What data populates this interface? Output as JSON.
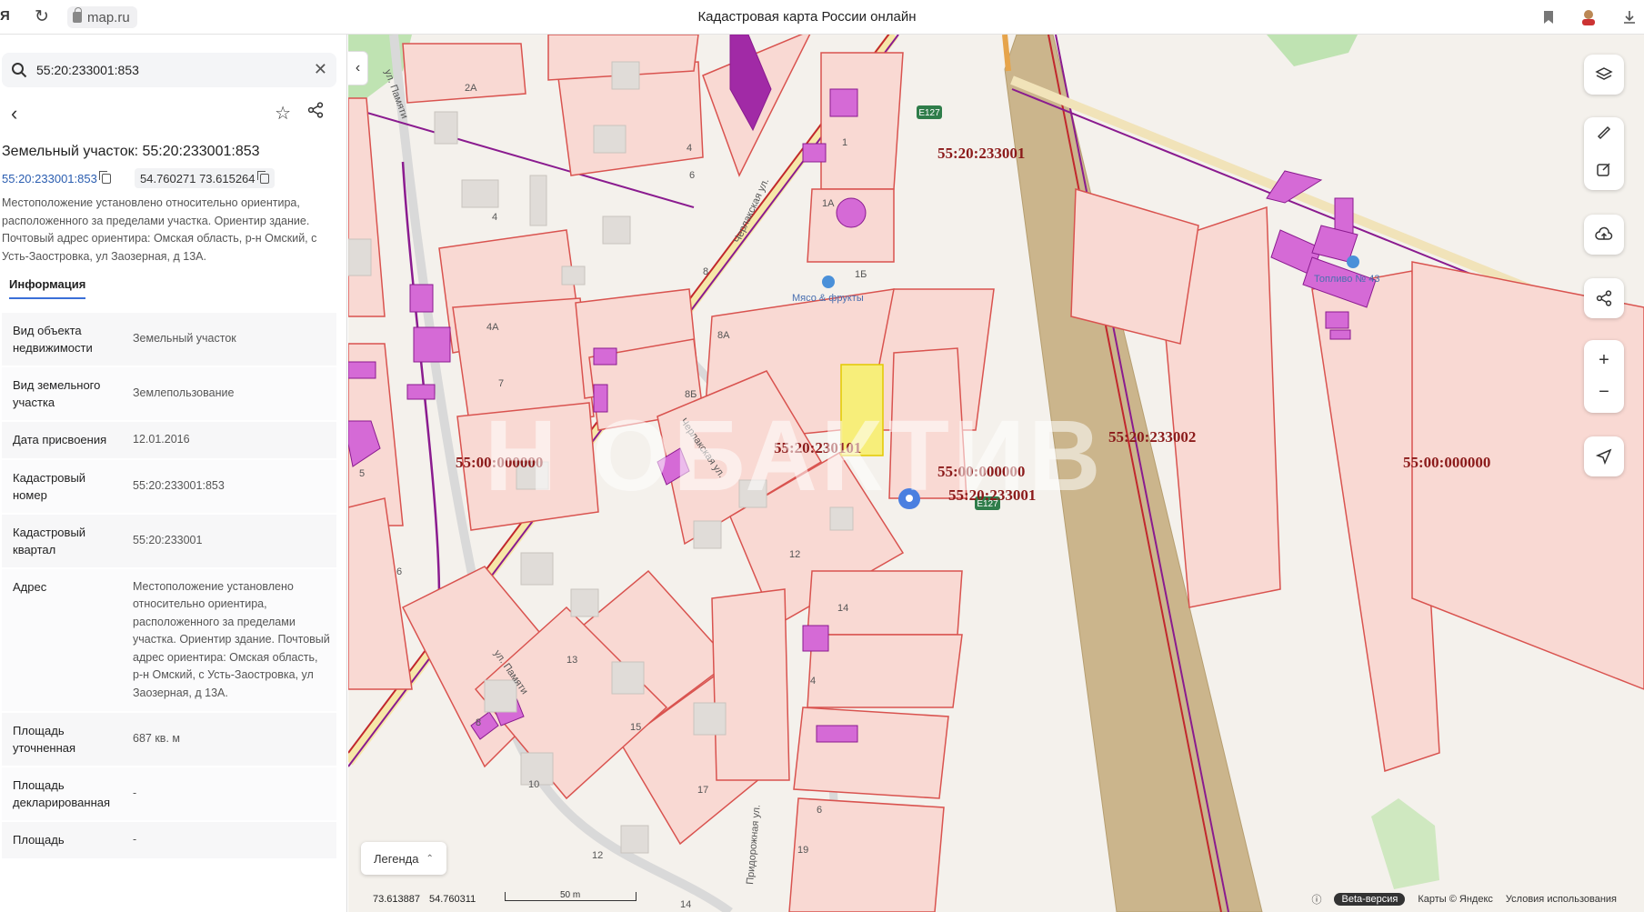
{
  "browser": {
    "brand": "Я",
    "url": "map.ru",
    "tab_title": "Кадастровая карта России онлайн"
  },
  "search": {
    "value": "55:20:233001:853"
  },
  "parcel": {
    "title": "Земельный участок: 55:20:233001:853",
    "cadastral_link": "55:20:233001:853",
    "coordinates": "54.760271 73.615264",
    "description": "Местоположение установлено относительно ориентира, расположенного за пределами участка. Ориентир здание. Почтовый адрес ориентира: Омская область, р-н Омский, с Усть-Заостровка, ул Заозерная, д 13А."
  },
  "tabs": {
    "info": "Информация"
  },
  "info_rows": [
    {
      "label": "Вид объекта недвижимости",
      "value": "Земельный участок"
    },
    {
      "label": "Вид земельного участка",
      "value": "Землепользование"
    },
    {
      "label": "Дата присвоения",
      "value": "12.01.2016"
    },
    {
      "label": "Кадастровый номер",
      "value": "55:20:233001:853"
    },
    {
      "label": "Кадастровый квартал",
      "value": "55:20:233001"
    },
    {
      "label": "Адрес",
      "value": "Местоположение установлено относительно ориентира, расположенного за пределами участка. Ориентир здание. Почтовый адрес ориентира: Омская область, р-н Омский, с Усть-Заостровка, ул Заозерная, д 13А."
    },
    {
      "label": "Площадь уточненная",
      "value": "687 кв. м"
    },
    {
      "label": "Площадь декларированная",
      "value": "-"
    },
    {
      "label": "Площадь",
      "value": "-"
    }
  ],
  "map": {
    "streets": [
      "ул. Памяти",
      "Черлакская ул.",
      "ул. Памяти",
      "Придорожная ул.",
      "Черлакская ул."
    ],
    "road_badges": [
      "E127",
      "E127"
    ],
    "quarter_labels": [
      "55:20:233001",
      "55:00:000000",
      "55:20:230101",
      "55:00:000000",
      "55:20:233001",
      "55:20:233002",
      "55:00:000000"
    ],
    "poi": [
      "Мясо & фрукты",
      "Топливо № 43"
    ],
    "house_numbers": [
      "2А",
      "4",
      "6",
      "4",
      "8",
      "1",
      "1А",
      "1Б",
      "4А",
      "7",
      "8А",
      "8Б",
      "5",
      "6",
      "12",
      "14",
      "13",
      "15",
      "17",
      "19",
      "8",
      "10",
      "12",
      "14",
      "4",
      "6"
    ],
    "watermark": "Н ОБАКТИВ"
  },
  "legend": {
    "label": "Легенда"
  },
  "status": {
    "lon": "73.613887",
    "lat": "54.760311",
    "scale": "50 m",
    "beta": "Beta-версия",
    "copyright": "Карты © Яндекс",
    "terms": "Условия использования"
  },
  "colors": {
    "parcel_fill": "#f9d9d3",
    "parcel_border": "#d9534f",
    "building": "#d56ad6",
    "selected": "#f7ee7a",
    "road_band": "#c9b48a"
  }
}
